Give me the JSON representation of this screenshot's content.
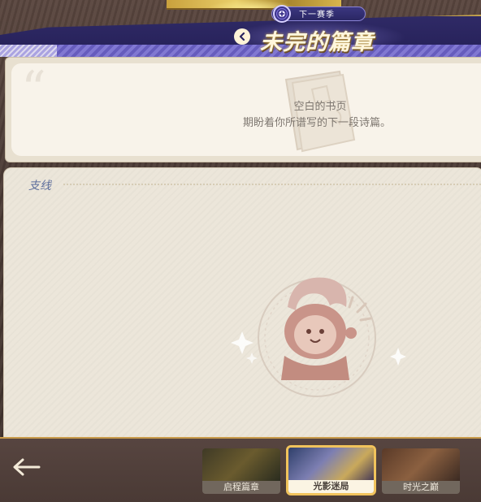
{
  "header": {
    "season_label": "下一赛季",
    "title": "未完的篇章"
  },
  "page_card": {
    "quote_mark": "“",
    "empty_title": "空白的书页",
    "empty_subtitle": "期盼着你所谱写的下一段诗篇。"
  },
  "side_section": {
    "label": "支线"
  },
  "chapters": [
    {
      "label": "启程篇章",
      "selected": false
    },
    {
      "label": "光影迷局",
      "selected": true
    },
    {
      "label": "时光之巅",
      "selected": false
    }
  ],
  "icons": {
    "season": "season-emblem-icon",
    "header_back": "chevron-left-icon",
    "empty_page": "book-icon",
    "mascot": "mascot-icon",
    "footer_back": "back-arrow-icon"
  },
  "colors": {
    "banner": "#2f2a66",
    "accent_gold": "#f1c35c",
    "side_label": "#5d6e9c"
  }
}
